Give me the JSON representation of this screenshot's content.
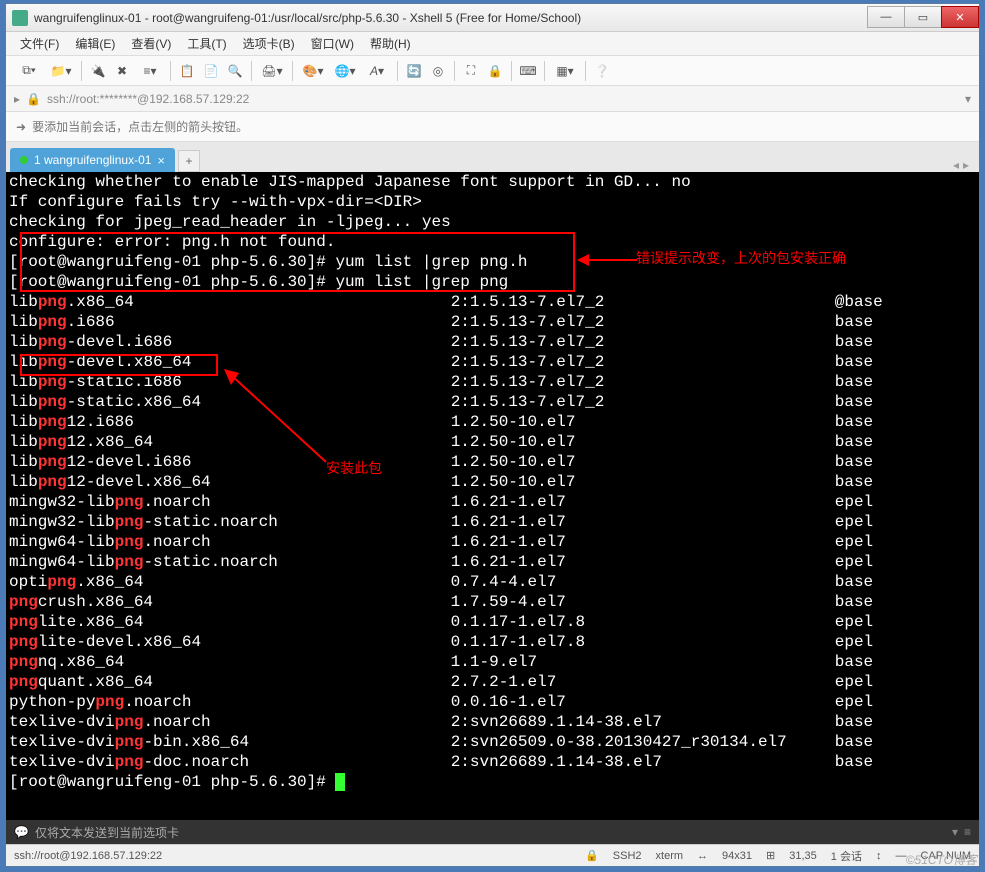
{
  "window": {
    "title": "wangruifenglinux-01 - root@wangruifeng-01:/usr/local/src/php-5.6.30 - Xshell 5 (Free for Home/School)"
  },
  "menubar": [
    "文件(F)",
    "编辑(E)",
    "查看(V)",
    "工具(T)",
    "选项卡(B)",
    "窗口(W)",
    "帮助(H)"
  ],
  "addressbar": {
    "lock_icon": "lock-icon",
    "text": "ssh://root:********@192.168.57.129:22"
  },
  "infobar": {
    "icon": "arrow-right-icon",
    "text": "要添加当前会话，点击左侧的箭头按钮。"
  },
  "tabs": [
    {
      "label": "1 wangruifenglinux-01",
      "active": true
    }
  ],
  "annotations": {
    "ann1": "错误提示改变，上次的包安装正确",
    "ann2": "安装此包"
  },
  "terminal": {
    "pre_lines": [
      "checking whether to enable JIS-mapped Japanese font support in GD... no",
      "If configure fails try --with-vpx-dir=<DIR>",
      "checking for jpeg_read_header in -ljpeg... yes",
      "configure: error: png.h not found."
    ],
    "prompts": [
      {
        "user": "root",
        "host": "wangruifeng-01",
        "dir": "php-5.6.30",
        "cmd": "yum list |grep png.h"
      },
      {
        "user": "root",
        "host": "wangruifeng-01",
        "dir": "php-5.6.30",
        "cmd": "yum list |grep png"
      }
    ],
    "packages": [
      {
        "pre": "lib",
        "hl": "png",
        "post": ".x86_64",
        "ver": "2:1.5.13-7.el7_2",
        "repo": "@base"
      },
      {
        "pre": "lib",
        "hl": "png",
        "post": ".i686",
        "ver": "2:1.5.13-7.el7_2",
        "repo": "base"
      },
      {
        "pre": "lib",
        "hl": "png",
        "post": "-devel.i686",
        "ver": "2:1.5.13-7.el7_2",
        "repo": "base"
      },
      {
        "pre": "lib",
        "hl": "png",
        "post": "-devel.x86_64",
        "ver": "2:1.5.13-7.el7_2",
        "repo": "base"
      },
      {
        "pre": "lib",
        "hl": "png",
        "post": "-static.i686",
        "ver": "2:1.5.13-7.el7_2",
        "repo": "base"
      },
      {
        "pre": "lib",
        "hl": "png",
        "post": "-static.x86_64",
        "ver": "2:1.5.13-7.el7_2",
        "repo": "base"
      },
      {
        "pre": "lib",
        "hl": "png",
        "post": "12.i686",
        "ver": "1.2.50-10.el7",
        "repo": "base"
      },
      {
        "pre": "lib",
        "hl": "png",
        "post": "12.x86_64",
        "ver": "1.2.50-10.el7",
        "repo": "base"
      },
      {
        "pre": "lib",
        "hl": "png",
        "post": "12-devel.i686",
        "ver": "1.2.50-10.el7",
        "repo": "base"
      },
      {
        "pre": "lib",
        "hl": "png",
        "post": "12-devel.x86_64",
        "ver": "1.2.50-10.el7",
        "repo": "base"
      },
      {
        "pre": "mingw32-lib",
        "hl": "png",
        "post": ".noarch",
        "ver": "1.6.21-1.el7",
        "repo": "epel"
      },
      {
        "pre": "mingw32-lib",
        "hl": "png",
        "post": "-static.noarch",
        "ver": "1.6.21-1.el7",
        "repo": "epel"
      },
      {
        "pre": "mingw64-lib",
        "hl": "png",
        "post": ".noarch",
        "ver": "1.6.21-1.el7",
        "repo": "epel"
      },
      {
        "pre": "mingw64-lib",
        "hl": "png",
        "post": "-static.noarch",
        "ver": "1.6.21-1.el7",
        "repo": "epel"
      },
      {
        "pre": "opti",
        "hl": "png",
        "post": ".x86_64",
        "ver": "0.7.4-4.el7",
        "repo": "base"
      },
      {
        "pre": "",
        "hl": "png",
        "post": "crush.x86_64",
        "ver": "1.7.59-4.el7",
        "repo": "base"
      },
      {
        "pre": "",
        "hl": "png",
        "post": "lite.x86_64",
        "ver": "0.1.17-1.el7.8",
        "repo": "epel"
      },
      {
        "pre": "",
        "hl": "png",
        "post": "lite-devel.x86_64",
        "ver": "0.1.17-1.el7.8",
        "repo": "epel"
      },
      {
        "pre": "",
        "hl": "png",
        "post": "nq.x86_64",
        "ver": "1.1-9.el7",
        "repo": "base"
      },
      {
        "pre": "",
        "hl": "png",
        "post": "quant.x86_64",
        "ver": "2.7.2-1.el7",
        "repo": "epel"
      },
      {
        "pre": "python-py",
        "hl": "png",
        "post": ".noarch",
        "ver": "0.0.16-1.el7",
        "repo": "epel"
      },
      {
        "pre": "texlive-dvi",
        "hl": "png",
        "post": ".noarch",
        "ver": "2:svn26689.1.14-38.el7",
        "repo": "base"
      },
      {
        "pre": "texlive-dvi",
        "hl": "png",
        "post": "-bin.x86_64",
        "ver": "2:svn26509.0-38.20130427_r30134.el7",
        "repo": "base"
      },
      {
        "pre": "texlive-dvi",
        "hl": "png",
        "post": "-doc.noarch",
        "ver": "2:svn26689.1.14-38.el7",
        "repo": "base"
      }
    ],
    "final_prompt": {
      "user": "root",
      "host": "wangruifeng-01",
      "dir": "php-5.6.30"
    }
  },
  "statusbar1": {
    "icon": "chat-icon",
    "text": "仅将文本发送到当前选项卡"
  },
  "statusbar2": {
    "host": "ssh://root@192.168.57.129:22",
    "ssh": "SSH2",
    "term": "xterm",
    "size": "94x31",
    "pos": "31,35",
    "sessions": "1 会话",
    "caps": "CAP NUM"
  },
  "watermark": "©51CTO博客"
}
